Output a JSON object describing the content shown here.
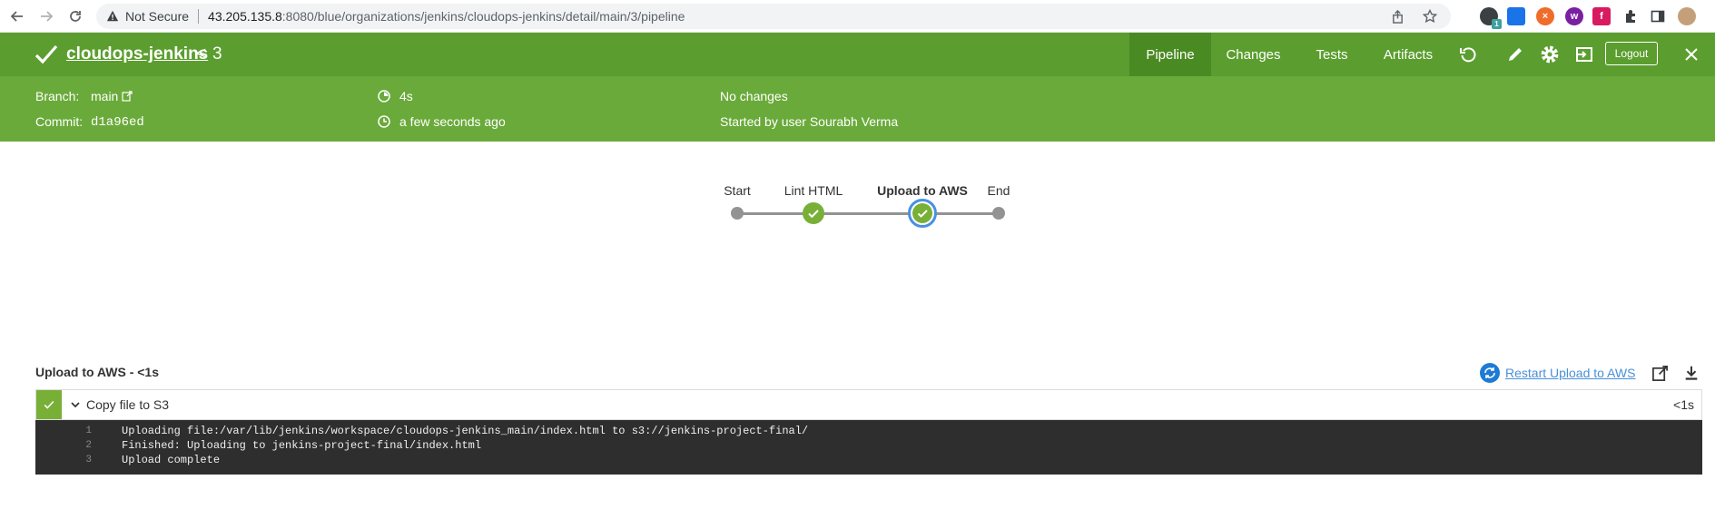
{
  "browser": {
    "security_label": "Not Secure",
    "url_host": "43.205.135.8",
    "url_path": ":8080/blue/organizations/jenkins/cloudops-jenkins/detail/main/3/pipeline",
    "extension_badge": "1"
  },
  "header": {
    "pipeline_name": "cloudops-jenkins",
    "run_separator": "<",
    "run_number": "3",
    "tabs": [
      {
        "label": "Pipeline",
        "active": true
      },
      {
        "label": "Changes",
        "active": false
      },
      {
        "label": "Tests",
        "active": false
      },
      {
        "label": "Artifacts",
        "active": false
      }
    ],
    "logout_label": "Logout",
    "success_color": "#5b9e2f"
  },
  "summary": {
    "branch_label": "Branch:",
    "branch_value": "main",
    "commit_label": "Commit:",
    "commit_value": "d1a96ed",
    "duration": "4s",
    "finished": "a few seconds ago",
    "changes": "No changes",
    "cause": "Started by user Sourabh Verma"
  },
  "pipeline": {
    "stages": [
      {
        "name": "Start",
        "status": "start"
      },
      {
        "name": "Lint HTML",
        "status": "success"
      },
      {
        "name": "Upload to AWS",
        "status": "success",
        "selected": true
      },
      {
        "name": "End",
        "status": "end"
      }
    ]
  },
  "log": {
    "title": "Upload to AWS - <1s",
    "restart_label": "Restart Upload to AWS",
    "step": {
      "name": "Copy file to S3",
      "duration": "<1s",
      "status": "success"
    },
    "lines": [
      {
        "num": "1",
        "text": "Uploading file:/var/lib/jenkins/workspace/cloudops-jenkins_main/index.html to s3://jenkins-project-final/"
      },
      {
        "num": "2",
        "text": "Finished: Uploading to jenkins-project-final/index.html"
      },
      {
        "num": "3",
        "text": "Upload complete"
      }
    ]
  }
}
